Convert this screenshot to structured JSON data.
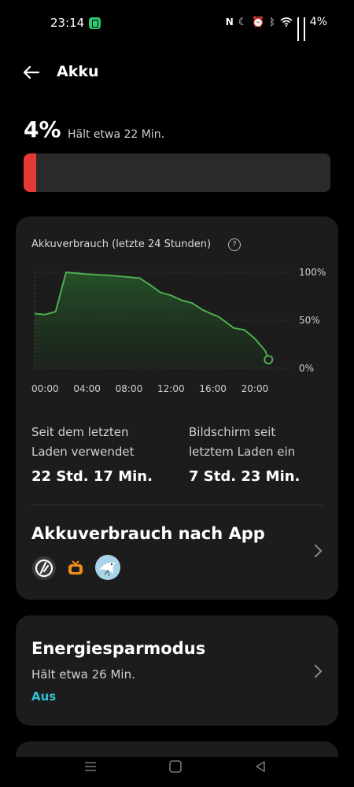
{
  "status_bar": {
    "time": "23:14",
    "battery": "4%",
    "icons": [
      "nfc-icon",
      "moon-icon",
      "alarm-icon",
      "bluetooth-icon",
      "wifi-icon",
      "signal-icon",
      "signal-icon"
    ]
  },
  "header": {
    "title": "Akku"
  },
  "battery": {
    "percent": "4%",
    "remaining": "Hält etwa 22 Min.",
    "level": 0.04,
    "color": "#e53935"
  },
  "usage_card": {
    "title": "Akkuverbrauch (letzte 24 Stunden)",
    "since_label_1": "Seit dem letzten",
    "since_label_2": "Laden verwendet",
    "since_value": "22 Std. 17 Min.",
    "screen_label_1": "Bildschirm seit",
    "screen_label_2": "letztem Laden ein",
    "screen_value": "7 Std. 23 Min.",
    "apps_title": "Akkuverbrauch nach App",
    "app_icons": [
      "app-icon-a",
      "app-icon-tv",
      "app-icon-bird"
    ]
  },
  "chart_data": {
    "type": "area",
    "x_ticks": [
      "00:00",
      "04:00",
      "08:00",
      "12:00",
      "16:00",
      "20:00"
    ],
    "y_ticks": [
      "100%",
      "50%",
      "0%"
    ],
    "ylim": [
      0,
      100
    ],
    "line_color": "#4caf50",
    "x": [
      0,
      1,
      2,
      3,
      5,
      7,
      9,
      10,
      11,
      12,
      13,
      14,
      15,
      16,
      17,
      17.5,
      18,
      19,
      20,
      21,
      22,
      22.3
    ],
    "values": [
      57,
      56,
      59,
      100,
      98,
      97,
      95,
      94,
      87,
      79,
      76,
      71,
      68,
      61,
      56,
      54,
      50,
      42,
      40,
      31,
      18,
      9
    ]
  },
  "energy_saver": {
    "title": "Energiesparmodus",
    "remaining": "Hält etwa 26 Min.",
    "state": "Aus",
    "state_color": "#2ec4d0"
  }
}
